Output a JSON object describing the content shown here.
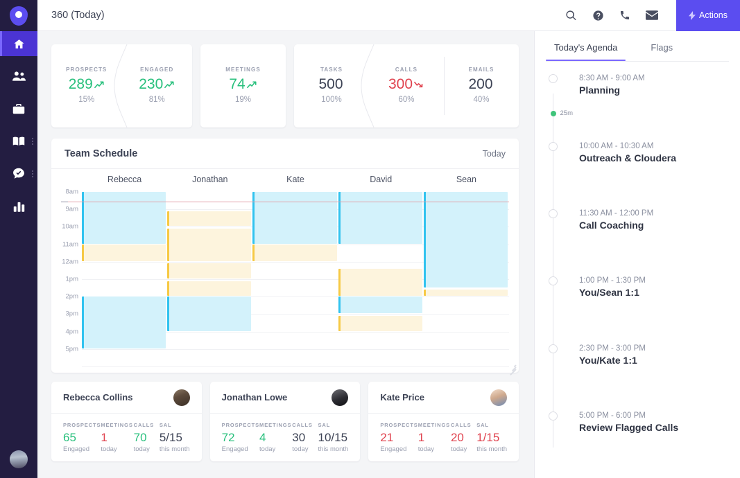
{
  "brand": {
    "accent": "#5b4df0",
    "rail_bg": "#231d41",
    "green": "#29c07d",
    "red": "#e0434f"
  },
  "rail": {
    "logo_name": "app-logo",
    "items": [
      {
        "name": "home",
        "icon": "home-icon",
        "active": true,
        "dots": false
      },
      {
        "name": "people",
        "icon": "people-icon",
        "active": false,
        "dots": false
      },
      {
        "name": "briefcase",
        "icon": "briefcase-icon",
        "active": false,
        "dots": false
      },
      {
        "name": "playbook",
        "icon": "book-icon",
        "active": false,
        "dots": true
      },
      {
        "name": "tasks",
        "icon": "chat-check-icon",
        "active": false,
        "dots": true
      },
      {
        "name": "reports",
        "icon": "bar-chart-icon",
        "active": false,
        "dots": false
      }
    ],
    "avatar_name": "user-avatar"
  },
  "topbar": {
    "title": "360 (Today)",
    "icons": [
      {
        "name": "search-icon"
      },
      {
        "name": "help-icon"
      },
      {
        "name": "phone-icon"
      },
      {
        "name": "mail-icon"
      }
    ],
    "actions_label": "Actions"
  },
  "kpis": [
    {
      "label": "PROSPECTS",
      "value": "289",
      "sub": "15%",
      "color": "green",
      "trend": "up"
    },
    {
      "label": "ENGAGED",
      "value": "230",
      "sub": "81%",
      "color": "green",
      "trend": "up"
    },
    {
      "label": "MEETINGS",
      "value": "74",
      "sub": "19%",
      "color": "green",
      "trend": "up"
    },
    {
      "label": "TASKS",
      "value": "500",
      "sub": "100%",
      "color": "dark",
      "trend": "none"
    },
    {
      "label": "CALLS",
      "value": "300",
      "sub": "60%",
      "color": "red",
      "trend": "down"
    },
    {
      "label": "EMAILS",
      "value": "200",
      "sub": "40%",
      "color": "dark",
      "trend": "none"
    }
  ],
  "schedule": {
    "title": "Team Schedule",
    "today_label": "Today",
    "columns": [
      "Rebecca",
      "Jonathan",
      "Kate",
      "David",
      "Sean"
    ],
    "times": [
      "8am",
      "9am",
      "10am",
      "11am",
      "12am",
      "1pm",
      "2pm",
      "3pm",
      "4pm",
      "5pm"
    ],
    "now_marker": true,
    "events": [
      {
        "col": 0,
        "start": 8.0,
        "end": 11.0,
        "type": "blue"
      },
      {
        "col": 0,
        "start": 11.0,
        "end": 12.0,
        "type": "yellow"
      },
      {
        "col": 0,
        "start": 14.0,
        "end": 17.0,
        "type": "blue"
      },
      {
        "col": 1,
        "start": 9.1,
        "end": 10.0,
        "type": "yellow"
      },
      {
        "col": 1,
        "start": 10.1,
        "end": 12.0,
        "type": "yellow"
      },
      {
        "col": 1,
        "start": 12.1,
        "end": 13.0,
        "type": "yellow"
      },
      {
        "col": 1,
        "start": 13.1,
        "end": 14.0,
        "type": "yellow"
      },
      {
        "col": 1,
        "start": 14.0,
        "end": 16.0,
        "type": "blue"
      },
      {
        "col": 2,
        "start": 8.0,
        "end": 11.0,
        "type": "blue"
      },
      {
        "col": 2,
        "start": 11.0,
        "end": 12.0,
        "type": "yellow"
      },
      {
        "col": 3,
        "start": 8.0,
        "end": 11.0,
        "type": "blue"
      },
      {
        "col": 3,
        "start": 12.4,
        "end": 14.0,
        "type": "yellow"
      },
      {
        "col": 3,
        "start": 14.0,
        "end": 15.0,
        "type": "blue"
      },
      {
        "col": 3,
        "start": 15.1,
        "end": 16.0,
        "type": "yellow"
      },
      {
        "col": 4,
        "start": 8.0,
        "end": 13.5,
        "type": "blue"
      },
      {
        "col": 4,
        "start": 13.6,
        "end": 14.0,
        "type": "yellow"
      }
    ]
  },
  "people": [
    {
      "name": "Rebecca Collins",
      "avatar": "avatar-rebecca",
      "stats": [
        {
          "label": "PROSPECTS",
          "value": "65",
          "sub": "Engaged",
          "color": "green"
        },
        {
          "label": "MEETINGS",
          "value": "1",
          "sub": "today",
          "color": "red"
        },
        {
          "label": "CALLS",
          "value": "70",
          "sub": "today",
          "color": "green"
        },
        {
          "label": "SAL",
          "value": "5/15",
          "sub": "this month",
          "color": "dark"
        }
      ]
    },
    {
      "name": "Jonathan Lowe",
      "avatar": "avatar-jonathan",
      "stats": [
        {
          "label": "PROSPECTS",
          "value": "72",
          "sub": "Engaged",
          "color": "green"
        },
        {
          "label": "MEETINGS",
          "value": "4",
          "sub": "today",
          "color": "green"
        },
        {
          "label": "CALLS",
          "value": "30",
          "sub": "today",
          "color": "dark"
        },
        {
          "label": "SAL",
          "value": "10/15",
          "sub": "this month",
          "color": "dark"
        }
      ]
    },
    {
      "name": "Kate Price",
      "avatar": "avatar-kate",
      "stats": [
        {
          "label": "PROSPECTS",
          "value": "21",
          "sub": "Engaged",
          "color": "red"
        },
        {
          "label": "MEETINGS",
          "value": "1",
          "sub": "today",
          "color": "red"
        },
        {
          "label": "CALLS",
          "value": "20",
          "sub": "today",
          "color": "red"
        },
        {
          "label": "SAL",
          "value": "1/15",
          "sub": "this month",
          "color": "red"
        }
      ]
    }
  ],
  "agenda": {
    "tabs": [
      {
        "label": "Today's Agenda",
        "active": true
      },
      {
        "label": "Flags",
        "active": false
      }
    ],
    "items": [
      {
        "time": "8:30 AM - 9:00 AM",
        "title": "Planning",
        "duration": "25m"
      },
      {
        "time": "10:00 AM - 10:30 AM",
        "title": "Outreach & Cloudera",
        "duration": null
      },
      {
        "time": "11:30 AM - 12:00 PM",
        "title": "Call Coaching",
        "duration": null
      },
      {
        "time": "1:00 PM - 1:30 PM",
        "title": "You/Sean 1:1",
        "duration": null
      },
      {
        "time": "2:30 PM - 3:00 PM",
        "title": "You/Kate 1:1",
        "duration": null
      },
      {
        "time": "5:00 PM - 6:00 PM",
        "title": "Review Flagged Calls",
        "duration": null
      }
    ]
  }
}
